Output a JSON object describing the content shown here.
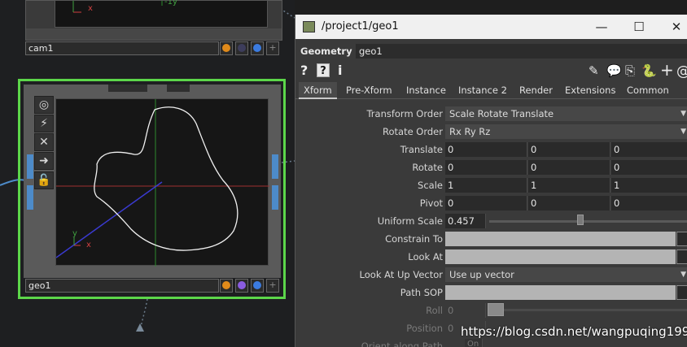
{
  "network": {
    "cam1": {
      "name": "cam1",
      "axis_x": "x",
      "axis_y_neg": "-1y",
      "dot_colors": [
        "#e08a1a",
        "#3d3d5c",
        "#3b7be0",
        "#555555"
      ]
    },
    "geo1": {
      "name": "geo1",
      "axis_x": "x",
      "axis_y": "y",
      "dot_colors": [
        "#e08a1a",
        "#8a5ce0",
        "#3b7be0",
        "#555555"
      ],
      "selected_color": "#5cd64a"
    },
    "toolbar_icons": [
      "eye-target-icon",
      "pulse-icon",
      "cross-icon",
      "arrow-right-icon",
      "lock-icon"
    ]
  },
  "panel": {
    "title": "/project1/geo1",
    "window_buttons": {
      "minimize": "—",
      "maximize": "☐",
      "close": "✕"
    },
    "op_type": "Geometry",
    "op_name": "geo1",
    "help": {
      "question": "?",
      "boxed": "?",
      "info": "i"
    },
    "right_icons": {
      "pencil": "✎",
      "comment": "💬",
      "clone": "⎘",
      "python": "🐍",
      "add": "+",
      "at": "@"
    },
    "tabs": [
      "Xform",
      "Pre-Xform",
      "Instance",
      "Instance 2",
      "Render",
      "Extensions",
      "Common"
    ],
    "active_tab": "Xform",
    "params": {
      "transform_order": {
        "label": "Transform Order",
        "value": "Scale Rotate Translate"
      },
      "rotate_order": {
        "label": "Rotate Order",
        "value": "Rx Ry Rz"
      },
      "translate": {
        "label": "Translate",
        "values": [
          "0",
          "0",
          "0"
        ]
      },
      "rotate": {
        "label": "Rotate",
        "values": [
          "0",
          "0",
          "0"
        ]
      },
      "scale": {
        "label": "Scale",
        "values": [
          "1",
          "1",
          "1"
        ]
      },
      "pivot": {
        "label": "Pivot",
        "values": [
          "0",
          "0",
          "0"
        ]
      },
      "uniform_scale": {
        "label": "Uniform Scale",
        "value": "0.457"
      },
      "constrain_to": {
        "label": "Constrain To",
        "value": ""
      },
      "look_at": {
        "label": "Look At",
        "value": ""
      },
      "look_at_up_vector": {
        "label": "Look At Up Vector",
        "value": "Use up vector"
      },
      "path_sop": {
        "label": "Path SOP",
        "value": ""
      },
      "roll": {
        "label": "Roll",
        "value": "0"
      },
      "position": {
        "label": "Position",
        "value": "0"
      },
      "orient_along_path": {
        "label": "Orient along Path",
        "value": "On"
      }
    }
  },
  "watermark": "https://blog.csdn.net/wangpuqing1997"
}
